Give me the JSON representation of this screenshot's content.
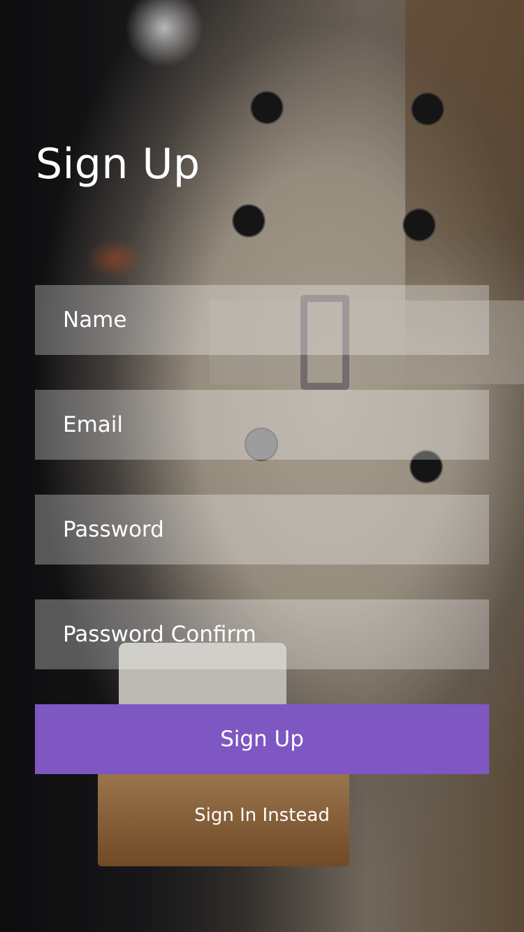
{
  "page": {
    "title": "Sign Up"
  },
  "form": {
    "fields": [
      {
        "placeholder": "Name",
        "value": ""
      },
      {
        "placeholder": "Email",
        "value": ""
      },
      {
        "placeholder": "Password",
        "value": ""
      },
      {
        "placeholder": "Password Confirm",
        "value": ""
      }
    ],
    "submit_label": "Sign Up",
    "alt_link_label": "Sign In Instead"
  },
  "colors": {
    "accent": "#7e57c2",
    "text": "#ffffff",
    "field_bg": "rgba(255,255,255,0.30)"
  }
}
